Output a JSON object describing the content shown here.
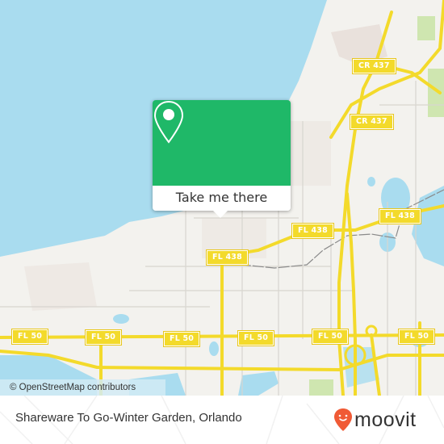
{
  "map": {
    "road_labels": [
      {
        "id": "cr437-top",
        "text": "CR 437"
      },
      {
        "id": "cr437-mid",
        "text": "CR 437"
      },
      {
        "id": "cr437-low",
        "text": "CR 437"
      },
      {
        "id": "fl438-east",
        "text": "FL 438"
      },
      {
        "id": "fl438-mid",
        "text": "FL 438"
      },
      {
        "id": "fl438-west",
        "text": "FL 438"
      },
      {
        "id": "fl50-1",
        "text": "FL 50"
      },
      {
        "id": "fl50-2",
        "text": "FL 50"
      },
      {
        "id": "fl50-3",
        "text": "FL 50"
      },
      {
        "id": "fl50-4",
        "text": "FL 50"
      },
      {
        "id": "fl50-5",
        "text": "FL 50"
      },
      {
        "id": "fl50-6",
        "text": "FL 50"
      }
    ],
    "attribution": "© OpenStreetMap contributors",
    "colors": {
      "water": "#a9dcef",
      "land": "#f3f2ee",
      "road": "#f3da2b",
      "park": "#cfe6b0"
    }
  },
  "popup": {
    "icon": "location-pin-icon",
    "button_label": "Take me there",
    "color": "#1fb868"
  },
  "footer": {
    "place_name": "Shareware To Go-Winter Garden, Orlando",
    "brand": "moovit",
    "brand_color": "#f05a35"
  }
}
